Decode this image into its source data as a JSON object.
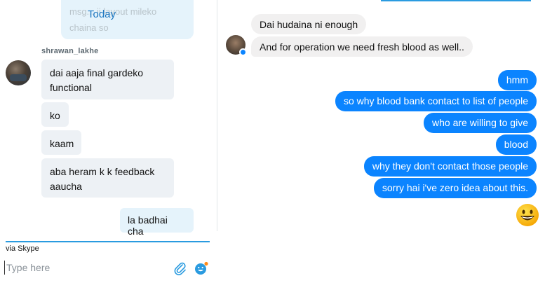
{
  "skype": {
    "prev_message_line1": "msg... ji layout mileko",
    "prev_message_line2": "chaina so",
    "date_divider": "Today",
    "sender_name": "shrawan_lakhe",
    "incoming": [
      "dai aaja final gardeko functional",
      "ko",
      "kaam",
      "aba heram k k feedback aaucha"
    ],
    "outgoing": "la badhai cha",
    "via": "via Skype",
    "input_placeholder": "Type here"
  },
  "messenger": {
    "incoming": [
      "Dai hudaina ni enough",
      "And for operation we need fresh blood as well.."
    ],
    "outgoing": [
      "hmm",
      "so why blood bank contact to list of people",
      "who are willing to give",
      "blood",
      "why they don't contact those people",
      "sorry hai i've zero idea about this."
    ],
    "reaction_emoji": "grinning-face"
  },
  "colors": {
    "skype_accent": "#2a9be0",
    "skype_incoming_bg": "#edf1f5",
    "skype_outgoing_bg": "#e5f3fb",
    "messenger_blue": "#0b84ff",
    "messenger_gray": "#f1f0f0"
  }
}
